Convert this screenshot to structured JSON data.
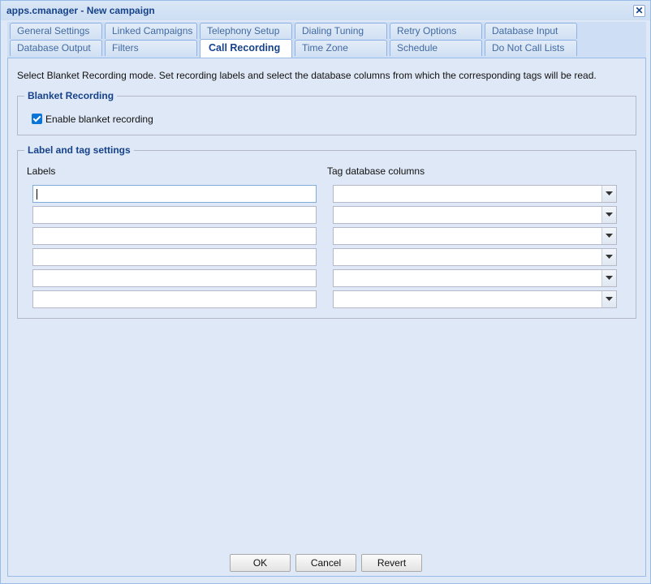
{
  "window": {
    "title": "apps.cmanager - New campaign",
    "close_symbol": "✕"
  },
  "tabs": {
    "row1": [
      "General Settings",
      "Linked Campaigns",
      "Telephony Setup",
      "Dialing Tuning",
      "Retry Options",
      "Database Input"
    ],
    "row2": [
      "Database Output",
      "Filters",
      "Call Recording",
      "Time Zone",
      "Schedule",
      "Do Not Call Lists"
    ],
    "active": "Call Recording"
  },
  "description": "Select Blanket Recording mode. Set recording labels and select the database columns from which the corresponding tags will be read.",
  "blanket": {
    "legend": "Blanket Recording",
    "checkbox_label": "Enable blanket recording",
    "checked": true
  },
  "tags": {
    "legend": "Label and tag settings",
    "labels_header": "Labels",
    "columns_header": "Tag database columns",
    "rows": [
      {
        "label": "",
        "column": ""
      },
      {
        "label": "",
        "column": ""
      },
      {
        "label": "",
        "column": ""
      },
      {
        "label": "",
        "column": ""
      },
      {
        "label": "",
        "column": ""
      },
      {
        "label": "",
        "column": ""
      }
    ]
  },
  "buttons": {
    "ok": "OK",
    "cancel": "Cancel",
    "revert": "Revert"
  },
  "colors": {
    "accent": "#15428b",
    "checkbox": "#0a75d8",
    "background": "#dfe8f6"
  }
}
